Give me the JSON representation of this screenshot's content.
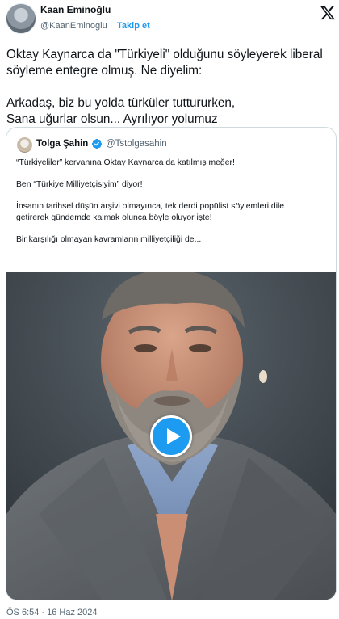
{
  "author": {
    "name": "Kaan Eminoğlu",
    "handle": "@KaanEminoglu",
    "separator": "·",
    "follow_label": "Takip et",
    "logo_icon": "x-logo-icon"
  },
  "tweet": {
    "lines": [
      "Oktay Kaynarca da \"Türkiyeli\" olduğunu söyleyerek liberal",
      "söyleme entegre olmuş. Ne diyelim:",
      "",
      "Arkadaş, biz bu yolda türküler tuttururken,",
      "Sana uğurlar olsun... Ayrılıyor yolumuz"
    ]
  },
  "quote": {
    "name": "Tolga Şahin",
    "handle": "@Tstolgasahin",
    "verified_icon": "verified-badge-icon",
    "lines": [
      "“Türkiyeliler” kervanına Oktay Kaynarca da katılmış meğer!",
      "",
      "Ben “Türkiye Milliyetçisiyim” diyor!",
      "",
      "İnsanın tarihsel düşün arşivi olmayınca, tek derdi popülist söylemleri dile",
      "getirerek gündemde kalmak olunca böyle oluyor işte!",
      "",
      "Bir karşılığı olmayan kavramların milliyetçiliği de..."
    ],
    "media": {
      "type": "video",
      "play_icon": "play-icon"
    }
  },
  "meta": {
    "timestamp": "ÖS 6:54 · 16 Haz 2024"
  },
  "colors": {
    "accent": "#1d9bf0",
    "text": "#0f1419",
    "secondary_text": "#536471",
    "border": "#cfd9de"
  }
}
